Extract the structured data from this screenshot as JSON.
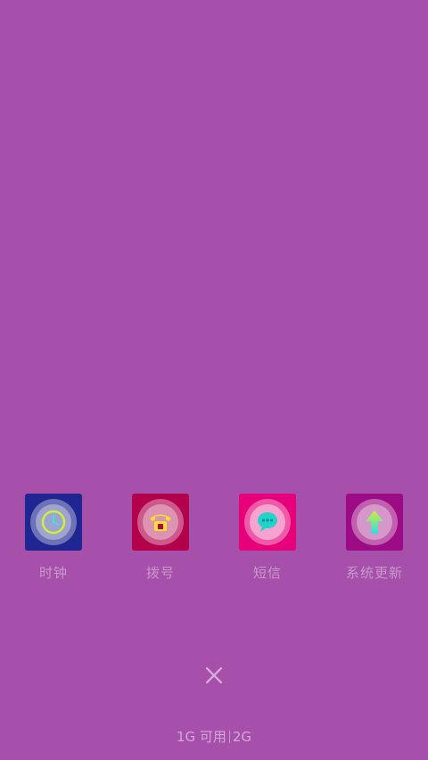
{
  "apps": [
    {
      "label": "时钟",
      "icon": "clock-icon",
      "bg": "#1f2591"
    },
    {
      "label": "拨号",
      "icon": "phone-icon",
      "bg": "#b3004d"
    },
    {
      "label": "短信",
      "icon": "sms-icon",
      "bg": "#e6007a"
    },
    {
      "label": "系统更新",
      "icon": "update-arrow-icon",
      "bg": "#9e0c85"
    }
  ],
  "memory": {
    "available": "1G 可用",
    "total": "2G"
  },
  "close_icon": "close-icon"
}
